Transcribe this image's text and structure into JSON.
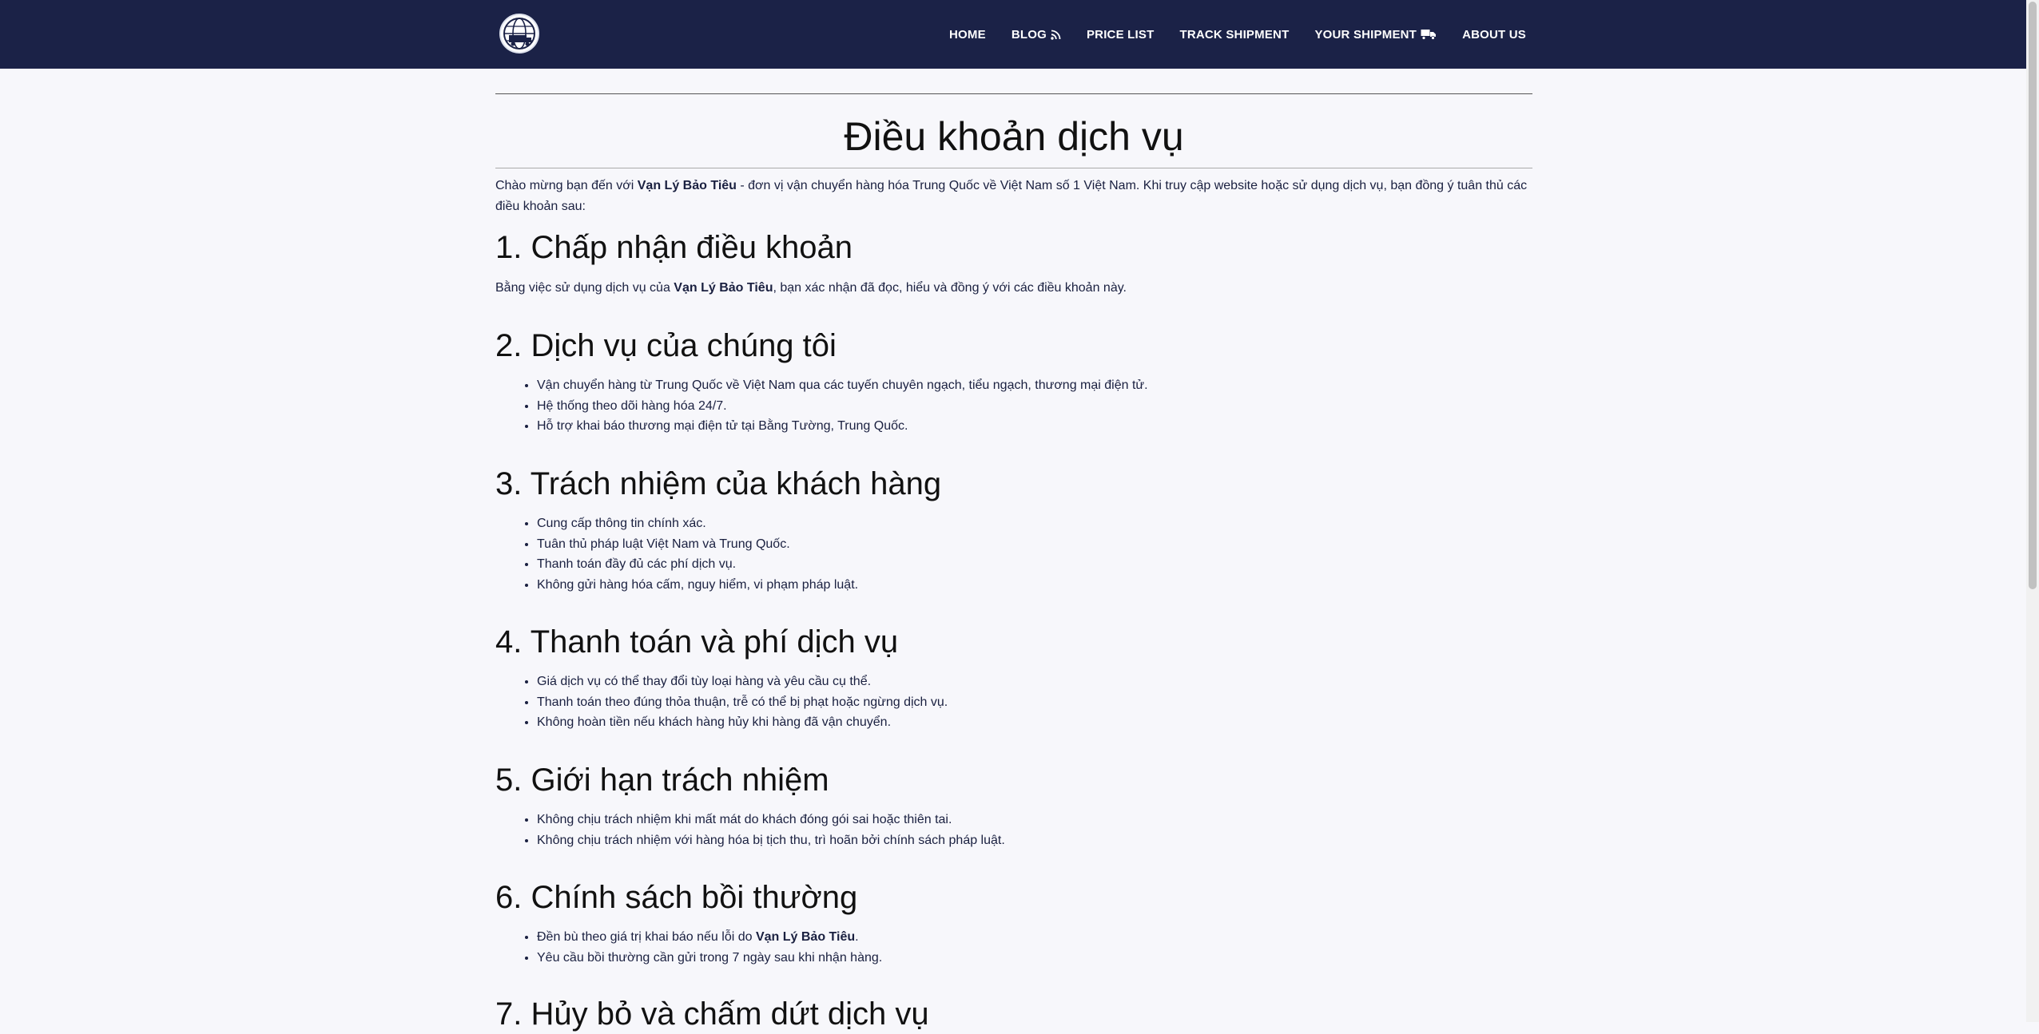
{
  "nav": {
    "links": [
      {
        "label": "HOME"
      },
      {
        "label": "BLOG"
      },
      {
        "label": "PRICE LIST"
      },
      {
        "label": "TRACK SHIPMENT"
      },
      {
        "label": "YOUR SHIPMENT"
      },
      {
        "label": "ABOUT US"
      }
    ]
  },
  "page": {
    "title": "Điều khoản dịch vụ",
    "intro_prefix": "Chào mừng bạn đến với ",
    "brand": "Vạn Lý Bảo Tiêu",
    "intro_suffix": " - đơn vị vận chuyển hàng hóa Trung Quốc về Việt Nam số 1 Việt Nam. Khi truy cập website hoặc sử dụng dịch vụ, bạn đồng ý tuân thủ các điều khoản sau:"
  },
  "sections": {
    "s1": {
      "title": "1. Chấp nhận điều khoản",
      "text_prefix": "Bằng việc sử dụng dịch vụ của ",
      "text_suffix": ", bạn xác nhận đã đọc, hiểu và đồng ý với các điều khoản này."
    },
    "s2": {
      "title": "2. Dịch vụ của chúng tôi",
      "items": [
        "Vận chuyển hàng từ Trung Quốc về Việt Nam qua các tuyến chuyên ngạch, tiểu ngạch, thương mại điện tử.",
        "Hệ thống theo dõi hàng hóa 24/7.",
        "Hỗ trợ khai báo thương mại điện tử tại Bằng Tường, Trung Quốc."
      ]
    },
    "s3": {
      "title": "3. Trách nhiệm của khách hàng",
      "items": [
        "Cung cấp thông tin chính xác.",
        "Tuân thủ pháp luật Việt Nam và Trung Quốc.",
        "Thanh toán đầy đủ các phí dịch vụ.",
        "Không gửi hàng hóa cấm, nguy hiểm, vi phạm pháp luật."
      ]
    },
    "s4": {
      "title": "4. Thanh toán và phí dịch vụ",
      "items": [
        "Giá dịch vụ có thể thay đổi tùy loại hàng và yêu cầu cụ thể.",
        "Thanh toán theo đúng thỏa thuận, trễ có thể bị phạt hoặc ngừng dịch vụ.",
        "Không hoàn tiền nếu khách hàng hủy khi hàng đã vận chuyển."
      ]
    },
    "s5": {
      "title": "5. Giới hạn trách nhiệm",
      "items": [
        "Không chịu trách nhiệm khi mất mát do khách đóng gói sai hoặc thiên tai.",
        "Không chịu trách nhiệm với hàng hóa bị tịch thu, trì hoãn bởi chính sách pháp luật."
      ]
    },
    "s6": {
      "title": "6. Chính sách bồi thường",
      "item1_prefix": "Đền bù theo giá trị khai báo nếu lỗi do ",
      "item1_suffix": ".",
      "item2": "Yêu cầu bồi thường cần gửi trong 7 ngày sau khi nhận hàng."
    },
    "s7": {
      "title": "7. Hủy bỏ và chấm dứt dịch vụ"
    }
  },
  "icons": {
    "blog": "rss-icon",
    "shipment": "truck-icon",
    "logo": "globe-logo-icon"
  },
  "colors": {
    "navbar": "#1b2247",
    "text": "#1a2040",
    "background": "#f7f7fb"
  }
}
